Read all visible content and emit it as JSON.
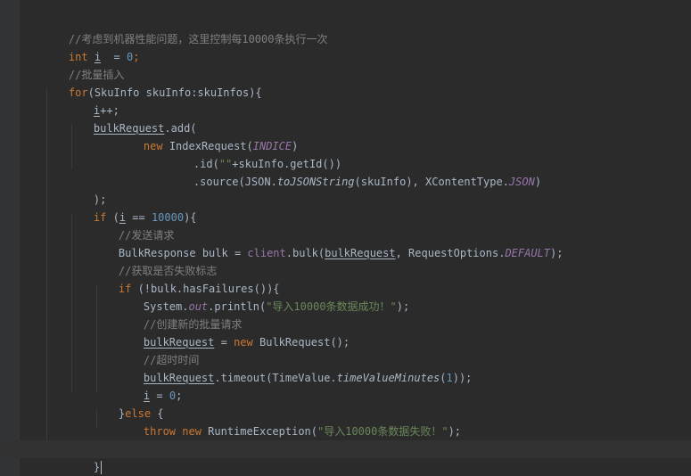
{
  "code": {
    "l1": {
      "comment": "//考虑到机器性能问题，这里控制每10000条执行一次"
    },
    "l2": {
      "kw": "int",
      "var": "i",
      "op": "  = ",
      "num": "0",
      "end": ";"
    },
    "l3": {
      "comment": "//批量插入"
    },
    "l4": {
      "kw": "for",
      "text": "(SkuInfo skuInfo:skuInfos){"
    },
    "l5": {
      "var": "i",
      "text": "++;"
    },
    "l6": {
      "var": "bulkRequest",
      "text": ".add("
    },
    "l7": {
      "kw": "new",
      "cls": " IndexRequest(",
      "const": "INDICE",
      "end": ")"
    },
    "l8": {
      "a": ".id(",
      "str": "\"\"",
      "b": "+skuInfo.getId())"
    },
    "l9": {
      "a": ".source(JSON.",
      "method": "toJSONString",
      "b": "(skuInfo), XContentType.",
      "const": "JSON",
      "c": ")"
    },
    "l10": {
      "text": ");"
    },
    "l11": {
      "kw": "if",
      "a": " (",
      "var": "i",
      "b": " == ",
      "num": "10000",
      "c": "){"
    },
    "l12": {
      "comment": "//发送请求"
    },
    "l13": {
      "a": "BulkResponse bulk = ",
      "fld": "client",
      "b": ".bulk(",
      "var": "bulkRequest",
      "c": ", RequestOptions.",
      "const": "DEFAULT",
      "d": ");"
    },
    "l14": {
      "comment": "//获取是否失败标志"
    },
    "l15": {
      "kw": "if",
      "text": " (!bulk.hasFailures()){"
    },
    "l16": {
      "a": "System.",
      "fld": "out",
      "b": ".println(",
      "str": "\"导入10000条数据成功！\"",
      "c": ");"
    },
    "l17": {
      "comment": "//创建新的批量请求"
    },
    "l18": {
      "var": "bulkRequest",
      "a": " = ",
      "kw": "new",
      "b": " BulkRequest();"
    },
    "l19": {
      "comment": "//超时时间"
    },
    "l20": {
      "var": "bulkRequest",
      "a": ".timeout(TimeValue.",
      "method": "timeValueMinutes",
      "b": "(",
      "num": "1",
      "c": "));"
    },
    "l21": {
      "var": "i",
      "a": " = ",
      "num": "0",
      "b": ";"
    },
    "l22": {
      "a": "}",
      "kw": "else",
      "b": " {"
    },
    "l23": {
      "kw1": "throw",
      "kw2": "new",
      "a": " RuntimeException(",
      "str": "\"导入10000条数据失败！\"",
      "b": ");"
    },
    "l24": {
      "text": "}"
    },
    "l25": {
      "text": "}"
    },
    "l26": {
      "text": "}"
    }
  },
  "colors": {
    "background": "#2b2b2b",
    "current_line": "#323232",
    "text": "#a9b7c6",
    "keyword": "#cc7832",
    "comment": "#808080",
    "number": "#6897bb",
    "string": "#6a8759",
    "field": "#9876aa"
  }
}
